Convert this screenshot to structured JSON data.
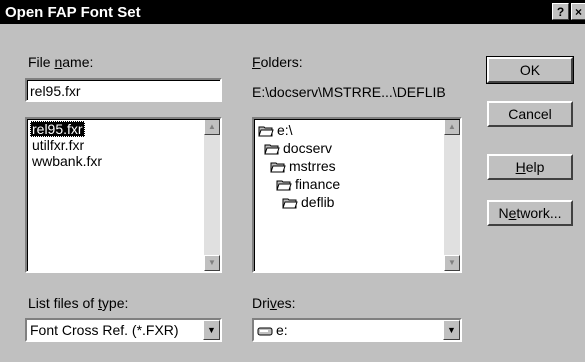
{
  "window": {
    "title": "Open FAP Font Set",
    "help_glyph": "?",
    "close_glyph": "×"
  },
  "file_name": {
    "label_pre": "File ",
    "label_accel": "n",
    "label_post": "ame:",
    "value": "rel95.fxr"
  },
  "files": [
    {
      "name": "rel95.fxr",
      "selected": true
    },
    {
      "name": "utilfxr.fxr",
      "selected": false
    },
    {
      "name": "wwbank.fxr",
      "selected": false
    }
  ],
  "folders": {
    "label_accel": "F",
    "label_post": "olders:",
    "current_path": "E:\\docserv\\MSTRRE...\\DEFLIB",
    "tree": [
      {
        "name": "e:\\",
        "icon": "open-folder-icon"
      },
      {
        "name": "docserv",
        "icon": "open-folder-icon"
      },
      {
        "name": "mstrres",
        "icon": "open-folder-icon"
      },
      {
        "name": "finance",
        "icon": "open-folder-icon"
      },
      {
        "name": "deflib",
        "icon": "open-folder-icon"
      }
    ]
  },
  "file_type": {
    "label_pre": "List files of ",
    "label_accel": "t",
    "label_post": "ype:",
    "value": "Font Cross Ref. (*.FXR)"
  },
  "drives": {
    "label_pre": "Dri",
    "label_accel": "v",
    "label_post": "es:",
    "value": "e:",
    "icon": "drive-icon"
  },
  "buttons": {
    "ok": "OK",
    "cancel": "Cancel",
    "help_accel": "H",
    "help_post": "elp",
    "network_pre": "N",
    "network_accel": "e",
    "network_post": "twork..."
  }
}
